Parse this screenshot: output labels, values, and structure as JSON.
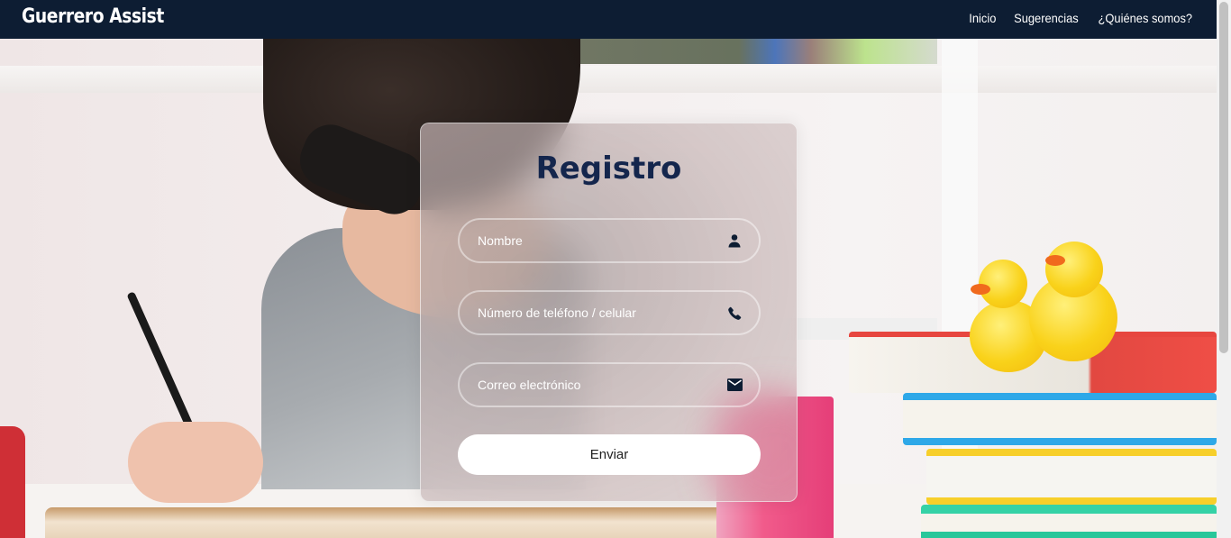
{
  "navbar": {
    "brand": "Guerrero Assist",
    "links": [
      {
        "label": "Inicio"
      },
      {
        "label": "Sugerencias"
      },
      {
        "label": "¿Quiénes somos?"
      }
    ]
  },
  "form": {
    "title": "Registro",
    "fields": [
      {
        "placeholder": "Nombre",
        "value": "",
        "icon": "user-icon"
      },
      {
        "placeholder": "Número de teléfono / celular",
        "value": "",
        "icon": "phone-icon"
      },
      {
        "placeholder": "Correo electrónico",
        "value": "",
        "icon": "mail-icon"
      }
    ],
    "submit_label": "Enviar"
  },
  "colors": {
    "navbar_bg": "#0d1d33",
    "title_color": "#14264d",
    "icon_color": "#0d1d33",
    "button_bg": "#ffffff"
  }
}
